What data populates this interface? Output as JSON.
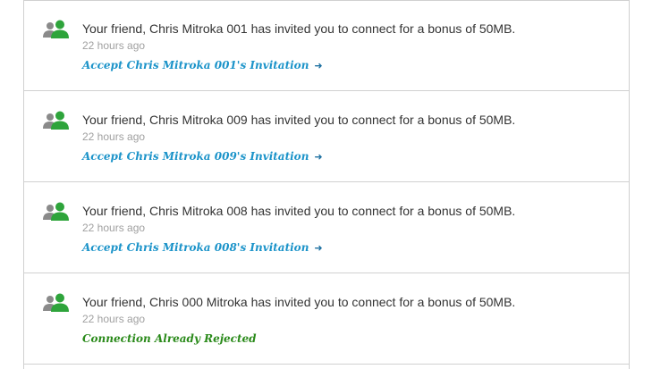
{
  "colors": {
    "link": "#1b93c9",
    "rejected": "#2a8a1a",
    "avatar_primary": "#2ea43b",
    "avatar_secondary": "#8a8a8a"
  },
  "feed": {
    "items": [
      {
        "message": "Your friend, Chris Mitroka 001 has invited you to connect for a bonus of 50MB.",
        "time": "22 hours ago",
        "action": "Accept Chris Mitroka 001's Invitation",
        "icon": "users-icon"
      },
      {
        "message": "Your friend, Chris Mitroka 009 has invited you to connect for a bonus of 50MB.",
        "time": "22 hours ago",
        "action": "Accept Chris Mitroka 009's Invitation",
        "icon": "users-icon"
      },
      {
        "message": "Your friend, Chris Mitroka 008 has invited you to connect for a bonus of 50MB.",
        "time": "22 hours ago",
        "action": "Accept Chris Mitroka 008's Invitation",
        "icon": "users-icon"
      },
      {
        "message": "Your friend, Chris 000 Mitroka has invited you to connect for a bonus of 50MB.",
        "time": "22 hours ago",
        "status": "Connection Already Rejected",
        "icon": "users-icon"
      }
    ]
  }
}
